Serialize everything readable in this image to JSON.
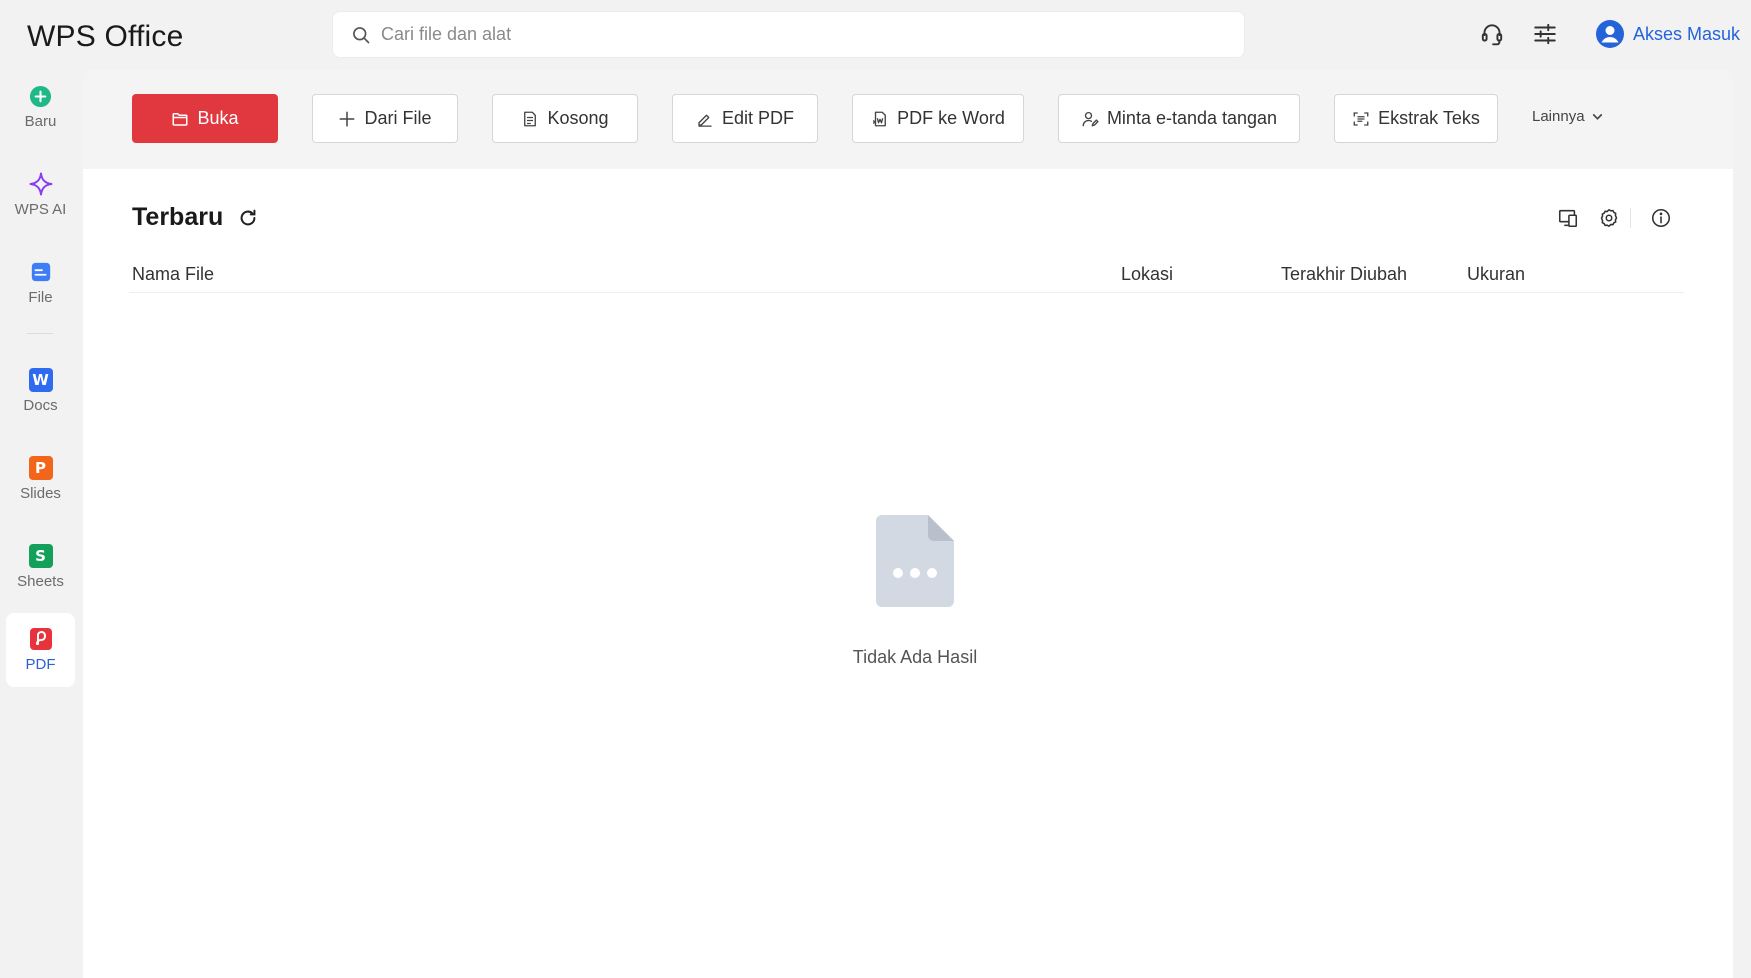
{
  "app": {
    "title": "WPS Office"
  },
  "search": {
    "placeholder": "Cari file dan alat"
  },
  "header": {
    "login_label": "Akses Masuk"
  },
  "sidebar": {
    "items": [
      {
        "label": "Baru"
      },
      {
        "label": "WPS AI"
      },
      {
        "label": "File"
      },
      {
        "label": "Docs",
        "badge": "W"
      },
      {
        "label": "Slides",
        "badge": "P"
      },
      {
        "label": "Sheets",
        "badge": "S"
      },
      {
        "label": "PDF"
      }
    ]
  },
  "toolbar": {
    "buttons": [
      {
        "label": "Buka"
      },
      {
        "label": "Dari File"
      },
      {
        "label": "Kosong"
      },
      {
        "label": "Edit PDF"
      },
      {
        "label": "PDF ke Word"
      },
      {
        "label": "Minta e-tanda tangan"
      },
      {
        "label": "Ekstrak Teks"
      }
    ],
    "more_label": "Lainnya"
  },
  "recent": {
    "title": "Terbaru",
    "columns": [
      "Nama File",
      "Lokasi",
      "Terakhir Diubah",
      "Ukuran"
    ],
    "empty_text": "Tidak Ada Hasil"
  },
  "colors": {
    "primary_red": "#e0383e",
    "accent_blue": "#2563d9",
    "new_green": "#1fb887",
    "ai_purple": "#8b3cf0",
    "docs_blue": "#2f6bf0",
    "slides_orange": "#f4651c",
    "sheets_green": "#13a05a",
    "pdf_red": "#e8323c"
  }
}
